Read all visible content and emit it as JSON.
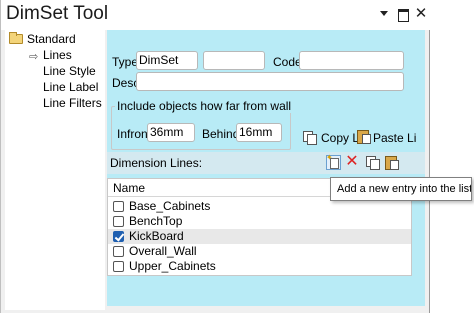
{
  "window": {
    "title": "DimSet Tool"
  },
  "tree": {
    "root": "Standard",
    "items": [
      "Lines",
      "Line Style",
      "Line Label",
      "Line Filters"
    ]
  },
  "form": {
    "type_label": "Type:",
    "type_value": "DimSet",
    "type_extra_value": "",
    "code_label": "Code:",
    "code_value": "",
    "desc_label": "Desc:",
    "desc_value": ""
  },
  "include_group": {
    "title": "Include objects how far from wall",
    "infront_label": "Infront:",
    "infront_value": "36mm",
    "behind_label": "Behind:",
    "behind_value": "16mm"
  },
  "actions": {
    "copy_label": "Copy Li",
    "paste_label": "Paste Li"
  },
  "dimension_lines": {
    "label": "Dimension Lines:",
    "column_header": "Name",
    "rows": [
      {
        "name": "Base_Cabinets",
        "checked": false
      },
      {
        "name": "BenchTop",
        "checked": false
      },
      {
        "name": "KickBoard",
        "checked": true
      },
      {
        "name": "Overall_Wall",
        "checked": false
      },
      {
        "name": "Upper_Cabinets",
        "checked": false
      }
    ]
  },
  "tooltip": {
    "text": "Add a new entry into the list"
  },
  "icons": {
    "pin": "pin-icon",
    "maximize": "maximize-icon",
    "close": "close-icon",
    "folder": "folder-icon",
    "arrow": "arrow-right-icon",
    "copy": "copy-icon",
    "paste": "paste-icon",
    "new_entry": "new-entry-icon",
    "delete": "delete-icon"
  },
  "colors": {
    "panel": "#b8ebf6",
    "check": "#1f5fb0",
    "delete": "#dd2222"
  }
}
